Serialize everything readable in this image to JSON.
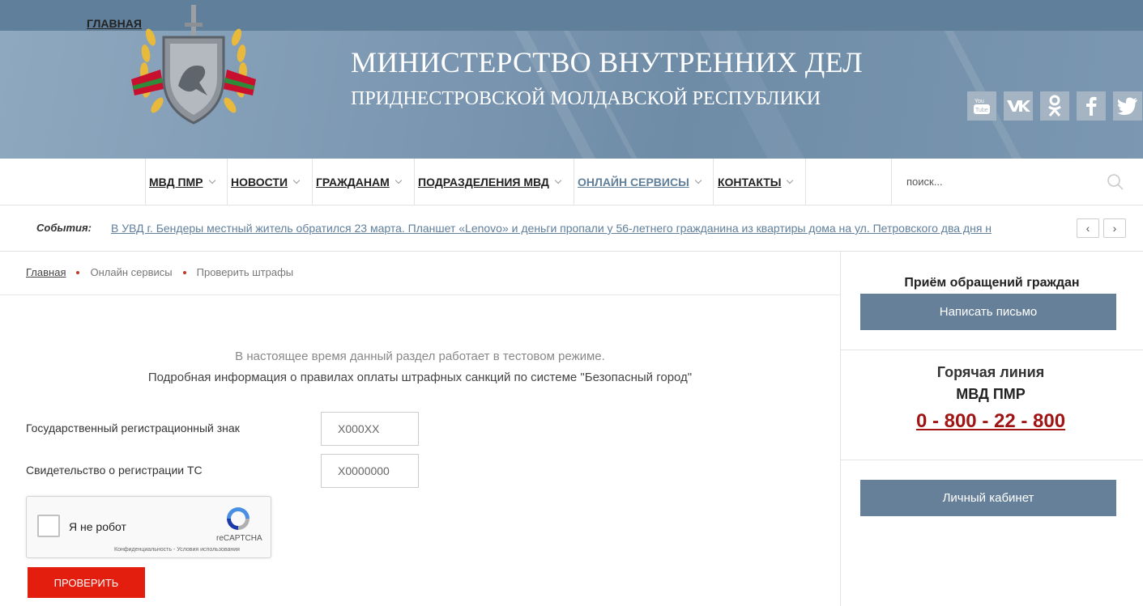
{
  "header": {
    "title": "МИНИСТЕРСТВО ВНУТРЕННИХ ДЕЛ",
    "subtitle": "ПРИДНЕСТРОВСКОЙ МОЛДАВСКОЙ РЕСПУБЛИКИ",
    "social": [
      "youtube-icon",
      "vk-icon",
      "odnoklassniki-icon",
      "facebook-icon",
      "twitter-icon"
    ],
    "colors": {
      "banner": "#7d98b2",
      "top_strip": "#5f7f9b"
    }
  },
  "nav": {
    "items": [
      {
        "label": "ГЛАВНАЯ",
        "dropdown": false
      },
      {
        "label": "МВД ПМР",
        "dropdown": true
      },
      {
        "label": "НОВОСТИ",
        "dropdown": true
      },
      {
        "label": "ГРАЖДАНАМ",
        "dropdown": true
      },
      {
        "label": "ПОДРАЗДЕЛЕНИЯ МВД",
        "dropdown": true
      },
      {
        "label": "ОНЛАЙН СЕРВИСЫ",
        "dropdown": true,
        "active": true
      },
      {
        "label": "КОНТАКТЫ",
        "dropdown": true
      }
    ],
    "search_placeholder": "поиск..."
  },
  "events": {
    "label": "События:",
    "text": "В УВД г. Бендеры местный житель обратился 23 марта. Планшет «Lenovo» и деньги пропали у 56-летнего гражданина из квартиры дома на ул. Петровского два дня н",
    "prev": "‹",
    "next": "›"
  },
  "breadcrumb": {
    "items": [
      "Главная",
      "Онлайн сервисы",
      "Проверить штрафы"
    ]
  },
  "main": {
    "notice_test": "В настоящее время данный раздел работает в тестовом режиме.",
    "notice_info": "Подробная информация о правилах оплаты штрафных санкций по системе \"Безопасный город\"",
    "form": {
      "plate_label": "Государственный регистрационный знак",
      "plate_placeholder": "Х000ХХ",
      "cert_label": "Свидетельство о регистрации ТС",
      "cert_placeholder": "Х0000000"
    },
    "captcha": {
      "label": "Я не робот",
      "brand": "reCAPTCHA",
      "links": "Конфиденциальность - Условия использования",
      "checked": false
    },
    "submit_label": "ПРОВЕРИТЬ",
    "submit_color": "#e31e0f"
  },
  "sidebar": {
    "appeals_title": "Приём обращений граждан",
    "write_button": "Написать письмо",
    "hotline_title": "Горячая линия",
    "hotline_org": "МВД ПМР",
    "hotline_phone": "0 - 800 - 22 - 800",
    "cabinet_button": "Личный кабинет",
    "button_color": "#668099",
    "phone_color": "#a01414"
  }
}
